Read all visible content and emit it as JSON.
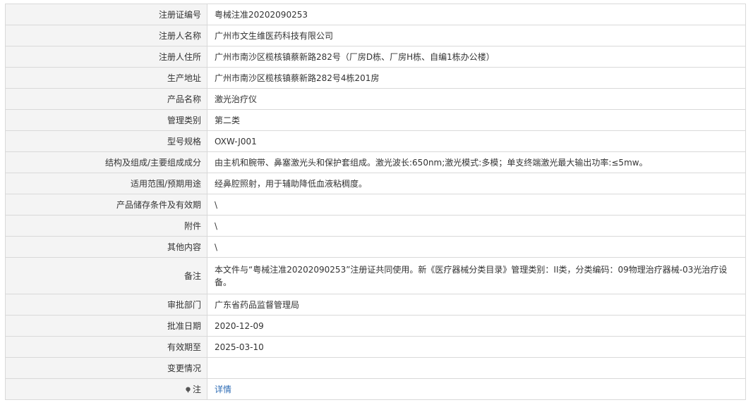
{
  "rows": [
    {
      "label": "注册证编号",
      "value": "粤械注准20202090253"
    },
    {
      "label": "注册人名称",
      "value": "广州市文生维医药科技有限公司"
    },
    {
      "label": "注册人住所",
      "value": "广州市南沙区榄核镇蔡新路282号（厂房D栋、厂房H栋、自编1栋办公楼）"
    },
    {
      "label": "生产地址",
      "value": "广州市南沙区榄核镇蔡新路282号4栋201房"
    },
    {
      "label": "产品名称",
      "value": "激光治疗仪"
    },
    {
      "label": "管理类别",
      "value": "第二类"
    },
    {
      "label": "型号规格",
      "value": "OXW-J001"
    },
    {
      "label": "结构及组成/主要组成成分",
      "value": "由主机和腕带、鼻塞激光头和保护套组成。激光波长:650nm;激光模式:多模；单支终端激光最大输出功率:≤5mw。"
    },
    {
      "label": "适用范围/预期用途",
      "value": "经鼻腔照射，用于辅助降低血液粘稠度。"
    },
    {
      "label": "产品储存条件及有效期",
      "value": "\\"
    },
    {
      "label": "附件",
      "value": "\\"
    },
    {
      "label": "其他内容",
      "value": "\\"
    },
    {
      "label": "备注",
      "value": "本文件与“粤械注准20202090253”注册证共同使用。新《医疗器械分类目录》管理类别：II类，分类编码：09物理治疗器械-03光治疗设备。"
    },
    {
      "label": "审批部门",
      "value": "广东省药品监督管理局"
    },
    {
      "label": "批准日期",
      "value": "2020-12-09"
    },
    {
      "label": "有效期至",
      "value": "2025-03-10"
    },
    {
      "label": "变更情况",
      "value": ""
    }
  ],
  "note_row": {
    "label": "注",
    "link_text": "详情",
    "icon": "pin-icon"
  },
  "colors": {
    "label_bg": "#f4f4f4",
    "border": "#d9d9d9",
    "link": "#2e6cb5"
  }
}
